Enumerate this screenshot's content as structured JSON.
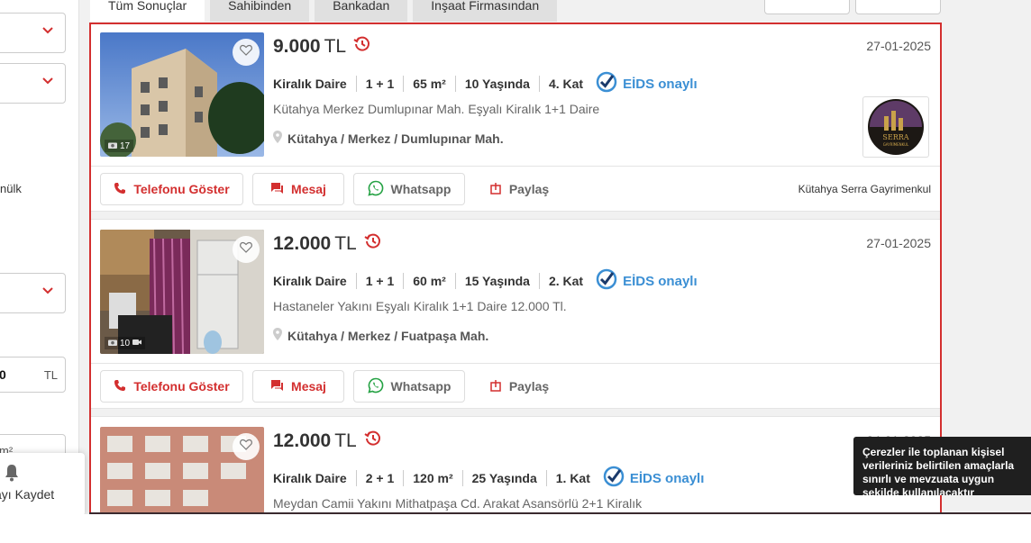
{
  "sidebar": {
    "fragment_text": "nülk",
    "price_value": "0",
    "price_currency": "TL",
    "area_unit": "m²",
    "save_search_label": "ayı Kaydet"
  },
  "tabs": [
    {
      "label": "Tüm Sonuçlar"
    },
    {
      "label": "Sahibinden"
    },
    {
      "label": "Bankadan"
    },
    {
      "label": "İnşaat Firmasından"
    }
  ],
  "listings": [
    {
      "price": "9.000",
      "currency": "TL",
      "date": "27-01-2025",
      "type": "Kiralık Daire",
      "rooms": "1 + 1",
      "area": "65 m²",
      "age": "10 Yaşında",
      "floor": "4. Kat",
      "eids": "EİDS onaylı",
      "description": "Kütahya Merkez Dumlupınar Mah. Eşyalı Kiralık 1+1 Daire",
      "location": "Kütahya / Merkez / Dumlupınar Mah.",
      "photo_count": "17",
      "phone_label": "Telefonu Göster",
      "message_label": "Mesaj",
      "whatsapp_label": "Whatsapp",
      "share_label": "Paylaş",
      "agency": "Kütahya Serra Gayrimenkul",
      "logo_text": "SERRA",
      "logo_sub": "GAYRİMENKUL"
    },
    {
      "price": "12.000",
      "currency": "TL",
      "date": "27-01-2025",
      "type": "Kiralık Daire",
      "rooms": "1 + 1",
      "area": "60 m²",
      "age": "15 Yaşında",
      "floor": "2. Kat",
      "eids": "EİDS onaylı",
      "description": "Hastaneler Yakını Eşyalı Kiralık 1+1 Daire 12.000 Tl.",
      "location": "Kütahya / Merkez / Fuatpaşa Mah.",
      "photo_count": "10",
      "phone_label": "Telefonu Göster",
      "message_label": "Mesaj",
      "whatsapp_label": "Whatsapp",
      "share_label": "Paylaş"
    },
    {
      "price": "12.000",
      "currency": "TL",
      "date": "24-01-2025",
      "type": "Kiralık Daire",
      "rooms": "2 + 1",
      "area": "120 m²",
      "age": "25 Yaşında",
      "floor": "1. Kat",
      "eids": "EİDS onaylı",
      "description": "Meydan Camii Yakını Mithatpaşa Cd. Arakat Asansörlü 2+1 Kiralık"
    }
  ],
  "cookie_notice": "Çerezler ile toplanan kişisel verileriniz belirtilen amaçlarla sınırlı ve mevzuata uygun şekilde kullanılacaktır",
  "colors": {
    "accent_red": "#d32f2f",
    "eids_blue": "#3b8fd4",
    "whatsapp_green": "#25a244"
  }
}
